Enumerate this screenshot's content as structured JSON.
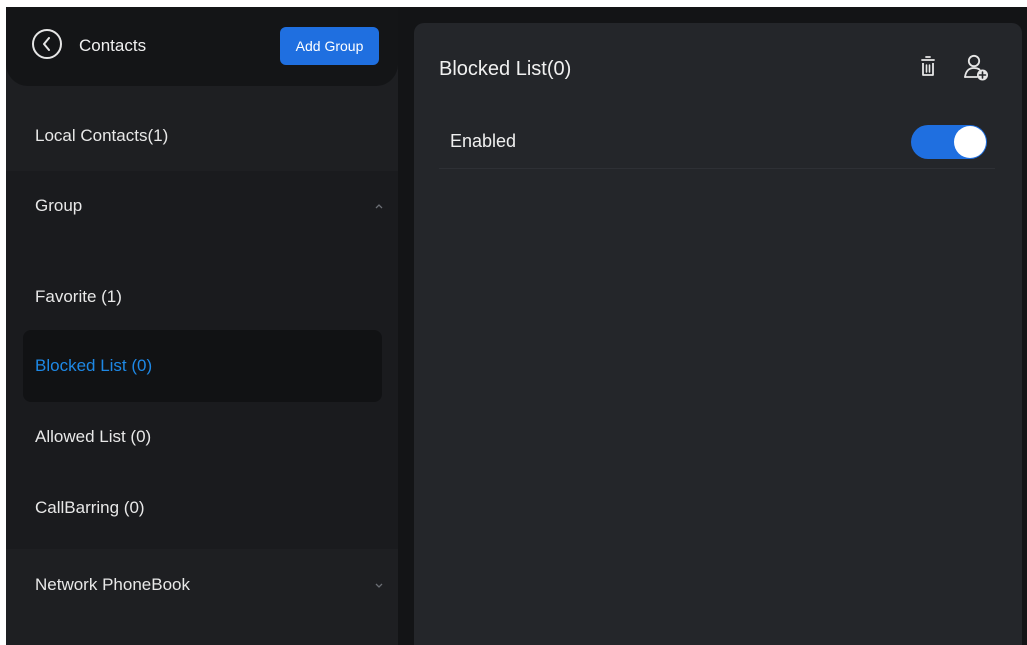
{
  "header": {
    "title": "Contacts",
    "add_group_label": "Add Group"
  },
  "sidebar": {
    "local_contacts": "Local Contacts(1)",
    "group_label": "Group",
    "group_items": [
      {
        "label": "Favorite  (1)"
      },
      {
        "label": "Blocked List  (0)",
        "selected": true
      },
      {
        "label": "Allowed List  (0)"
      },
      {
        "label": "CallBarring  (0)"
      }
    ],
    "network_phonebook": "Network PhoneBook"
  },
  "main": {
    "title": "Blocked List(0)",
    "enabled_label": "Enabled",
    "enabled": true
  },
  "icons": {
    "back": "back-icon",
    "delete": "trash-icon",
    "add_contact": "add-user-icon",
    "group_expander": "chevron-up-icon",
    "network_expander": "chevron-down-icon"
  },
  "colors": {
    "accent": "#1f6fe0",
    "selected_text": "#1e88e5",
    "background": "#131416",
    "panel": "#24262a"
  }
}
